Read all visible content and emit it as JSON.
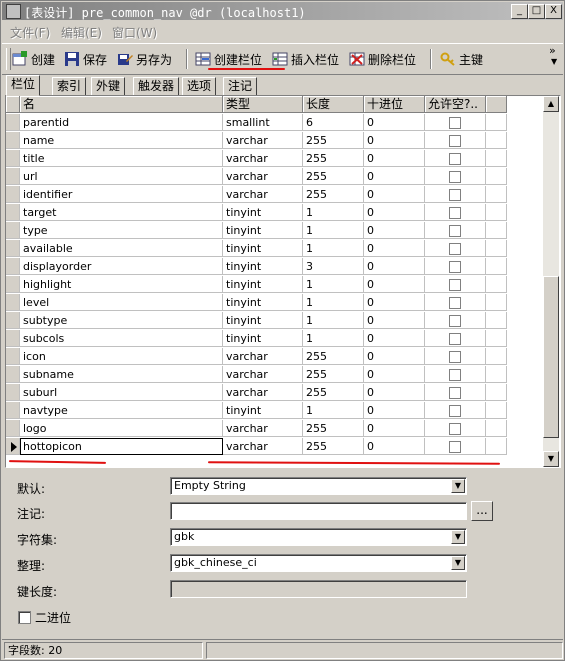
{
  "window": {
    "title": "[表设计] pre_common_nav @dr (localhost1)",
    "buttons": [
      "_",
      "□",
      "X"
    ]
  },
  "menu": [
    "文件(F)",
    "编辑(E)",
    "窗口(W)"
  ],
  "toolbar": {
    "create": "创建",
    "save": "保存",
    "save_as": "另存为",
    "create_column": "创建栏位",
    "insert_column": "插入栏位",
    "delete_column": "删除栏位",
    "primary_key": "主键",
    "overflow": "»"
  },
  "tabs": [
    "栏位",
    "索引",
    "外键",
    "触发器",
    "选项",
    "注记"
  ],
  "grid": {
    "headers": [
      "名",
      "类型",
      "长度",
      "十进位",
      "允许空?.."
    ],
    "rows": [
      {
        "name": "parentid",
        "type": "smallint",
        "length": "6",
        "decimals": "0"
      },
      {
        "name": "name",
        "type": "varchar",
        "length": "255",
        "decimals": "0"
      },
      {
        "name": "title",
        "type": "varchar",
        "length": "255",
        "decimals": "0"
      },
      {
        "name": "url",
        "type": "varchar",
        "length": "255",
        "decimals": "0"
      },
      {
        "name": "identifier",
        "type": "varchar",
        "length": "255",
        "decimals": "0"
      },
      {
        "name": "target",
        "type": "tinyint",
        "length": "1",
        "decimals": "0"
      },
      {
        "name": "type",
        "type": "tinyint",
        "length": "1",
        "decimals": "0"
      },
      {
        "name": "available",
        "type": "tinyint",
        "length": "1",
        "decimals": "0"
      },
      {
        "name": "displayorder",
        "type": "tinyint",
        "length": "3",
        "decimals": "0"
      },
      {
        "name": "highlight",
        "type": "tinyint",
        "length": "1",
        "decimals": "0"
      },
      {
        "name": "level",
        "type": "tinyint",
        "length": "1",
        "decimals": "0"
      },
      {
        "name": "subtype",
        "type": "tinyint",
        "length": "1",
        "decimals": "0"
      },
      {
        "name": "subcols",
        "type": "tinyint",
        "length": "1",
        "decimals": "0"
      },
      {
        "name": "icon",
        "type": "varchar",
        "length": "255",
        "decimals": "0"
      },
      {
        "name": "subname",
        "type": "varchar",
        "length": "255",
        "decimals": "0"
      },
      {
        "name": "suburl",
        "type": "varchar",
        "length": "255",
        "decimals": "0"
      },
      {
        "name": "navtype",
        "type": "tinyint",
        "length": "1",
        "decimals": "0"
      },
      {
        "name": "logo",
        "type": "varchar",
        "length": "255",
        "decimals": "0"
      },
      {
        "name": "hottopicon",
        "type": "varchar",
        "length": "255",
        "decimals": "0"
      }
    ]
  },
  "props": {
    "default_label": "默认:",
    "default_value": "Empty String",
    "comment_label": "注记:",
    "comment_value": "",
    "ellipsis": "...",
    "charset_label": "字符集:",
    "charset_value": "gbk",
    "collation_label": "整理:",
    "collation_value": "gbk_chinese_ci",
    "keylen_label": "键长度:",
    "keylen_value": "",
    "binary_label": "二进位"
  },
  "status": {
    "field_count": "字段数: 20"
  },
  "colors": {
    "annotation": "#e01010",
    "window_bg": "#d4d0c8"
  }
}
